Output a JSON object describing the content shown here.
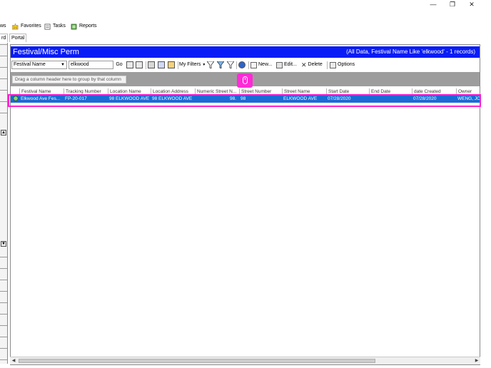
{
  "window": {
    "minimize": "—",
    "restore": "❐",
    "close": "✕"
  },
  "menu": [
    {
      "label": "ws"
    },
    {
      "label": "Favorites",
      "icon": "star-folder-icon"
    },
    {
      "label": "Tasks",
      "icon": "tasks-icon"
    },
    {
      "label": "Reports",
      "icon": "reports-icon"
    }
  ],
  "tabs": {
    "left": "rd",
    "portal": "Portal"
  },
  "header": {
    "title": "Festival/Misc Perm",
    "info": "(All Data, Festival Name Like 'elkwood' - 1 records)"
  },
  "toolbar": {
    "field_select": "Festival Name",
    "search_value": "elkwood",
    "go": "Go",
    "my_filters": "My Filters",
    "new": "New...",
    "edit": "Edit...",
    "delete": "Delete",
    "options": "Options"
  },
  "grid": {
    "group_hint": "Drag a column header here to group by that column",
    "columns": [
      "Festival Name",
      "Tracking Number",
      "Location Name",
      "Location Address",
      "Numeric Street N...",
      "Street Number",
      "Street Name",
      "Start Date",
      "End Date",
      "date Created",
      "Owner"
    ],
    "rows": [
      {
        "festival_name": "Elkwood Ave Fes...",
        "tracking_number": "FP-20-017",
        "location_name": "98 ELKWOOD AVE",
        "location_address": "98 ELKWOOD AVE",
        "numeric_street": "98.",
        "street_number": "98",
        "street_name": "ELKWOOD AVE",
        "start_date": "07/28/2020",
        "end_date": "",
        "date_created": "07/28/2020",
        "owner": "WENG, JO"
      }
    ]
  },
  "colors": {
    "header_blue": "#0a1cf5",
    "row_selected": "#1d6ad6",
    "highlight": "#ff1fd0"
  }
}
